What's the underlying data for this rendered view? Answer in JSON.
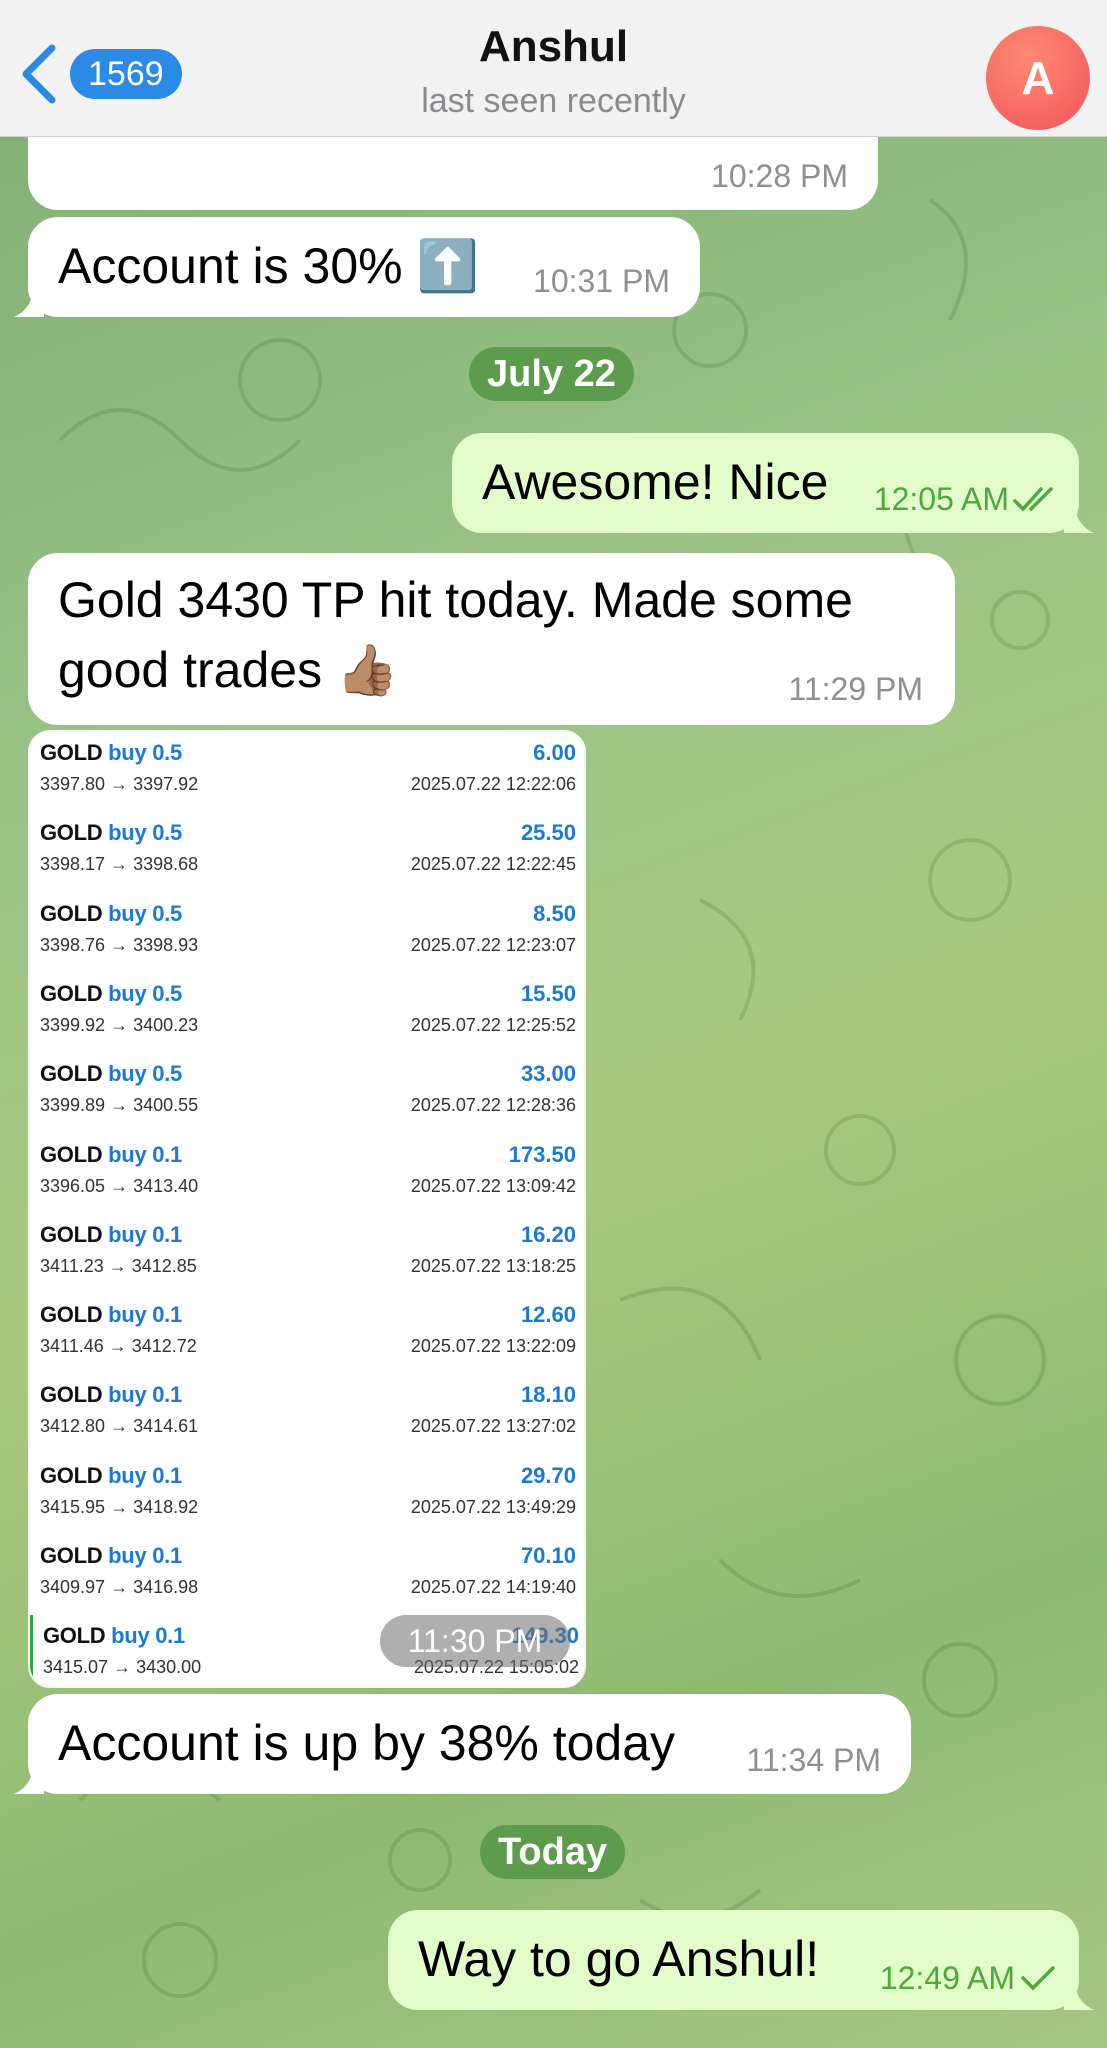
{
  "header": {
    "back_count": "1569",
    "contact_name": "Anshul",
    "status": "last seen recently",
    "avatar_letter": "A"
  },
  "messages": {
    "m0": {
      "time": "10:28 PM"
    },
    "m1": {
      "text": "Account is 30% ⬆️",
      "time": "10:31 PM"
    },
    "date1": "July 22",
    "m2": {
      "text": "Awesome! Nice",
      "time": "12:05 AM",
      "status": "read"
    },
    "m3": {
      "line1": "Gold 3430 TP hit today. Made some",
      "line2": "good trades 👍🏽",
      "time": "11:29 PM"
    },
    "image_time": "11:30 PM",
    "m4": {
      "text": "Account is up by 38% today",
      "time": "11:34 PM"
    },
    "date2": "Today",
    "m5": {
      "text": "Way to go Anshul!",
      "time": "12:49 AM",
      "status": "sent"
    }
  },
  "trades": [
    {
      "symbol": "GOLD",
      "side": "buy 0.5",
      "prices": "3397.80 → 3397.92",
      "profit": "6.00",
      "date": "2025.07.22 12:22:06"
    },
    {
      "symbol": "GOLD",
      "side": "buy 0.5",
      "prices": "3398.17 → 3398.68",
      "profit": "25.50",
      "date": "2025.07.22 12:22:45"
    },
    {
      "symbol": "GOLD",
      "side": "buy 0.5",
      "prices": "3398.76 → 3398.93",
      "profit": "8.50",
      "date": "2025.07.22 12:23:07"
    },
    {
      "symbol": "GOLD",
      "side": "buy 0.5",
      "prices": "3399.92 → 3400.23",
      "profit": "15.50",
      "date": "2025.07.22 12:25:52"
    },
    {
      "symbol": "GOLD",
      "side": "buy 0.5",
      "prices": "3399.89 → 3400.55",
      "profit": "33.00",
      "date": "2025.07.22 12:28:36"
    },
    {
      "symbol": "GOLD",
      "side": "buy 0.1",
      "prices": "3396.05 → 3413.40",
      "profit": "173.50",
      "date": "2025.07.22 13:09:42"
    },
    {
      "symbol": "GOLD",
      "side": "buy 0.1",
      "prices": "3411.23 → 3412.85",
      "profit": "16.20",
      "date": "2025.07.22 13:18:25"
    },
    {
      "symbol": "GOLD",
      "side": "buy 0.1",
      "prices": "3411.46 → 3412.72",
      "profit": "12.60",
      "date": "2025.07.22 13:22:09"
    },
    {
      "symbol": "GOLD",
      "side": "buy 0.1",
      "prices": "3412.80 → 3414.61",
      "profit": "18.10",
      "date": "2025.07.22 13:27:02"
    },
    {
      "symbol": "GOLD",
      "side": "buy 0.1",
      "prices": "3415.95 → 3418.92",
      "profit": "29.70",
      "date": "2025.07.22 13:49:29"
    },
    {
      "symbol": "GOLD",
      "side": "buy 0.1",
      "prices": "3409.97 → 3416.98",
      "profit": "70.10",
      "date": "2025.07.22 14:19:40"
    },
    {
      "symbol": "GOLD",
      "side": "buy 0.1",
      "prices": "3415.07 → 3430.00",
      "profit": "149.30",
      "date": "2025.07.22 15:05:02"
    }
  ],
  "colors": {
    "incoming_bubble": "#ffffff",
    "outgoing_bubble": "#e3fdca",
    "accent": "#2a8ae6",
    "outgoing_time": "#4caa3c"
  }
}
